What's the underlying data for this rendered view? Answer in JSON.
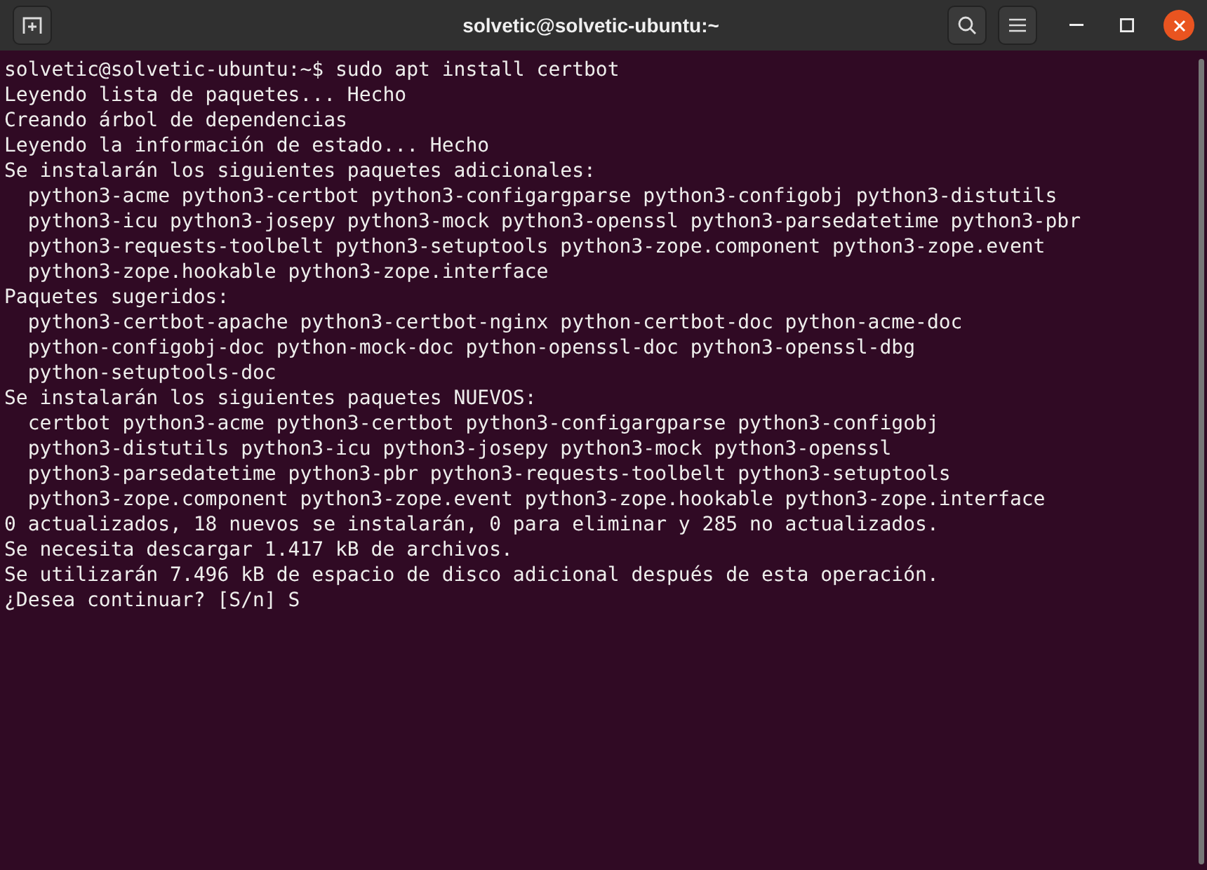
{
  "window": {
    "title": "solvetic@solvetic-ubuntu:~"
  },
  "terminal": {
    "lines": [
      "solvetic@solvetic-ubuntu:~$ sudo apt install certbot",
      "Leyendo lista de paquetes... Hecho",
      "Creando árbol de dependencias",
      "Leyendo la información de estado... Hecho",
      "Se instalarán los siguientes paquetes adicionales:",
      "  python3-acme python3-certbot python3-configargparse python3-configobj python3-distutils",
      "  python3-icu python3-josepy python3-mock python3-openssl python3-parsedatetime python3-pbr",
      "  python3-requests-toolbelt python3-setuptools python3-zope.component python3-zope.event",
      "  python3-zope.hookable python3-zope.interface",
      "Paquetes sugeridos:",
      "  python3-certbot-apache python3-certbot-nginx python-certbot-doc python-acme-doc",
      "  python-configobj-doc python-mock-doc python-openssl-doc python3-openssl-dbg",
      "  python-setuptools-doc",
      "Se instalarán los siguientes paquetes NUEVOS:",
      "  certbot python3-acme python3-certbot python3-configargparse python3-configobj",
      "  python3-distutils python3-icu python3-josepy python3-mock python3-openssl",
      "  python3-parsedatetime python3-pbr python3-requests-toolbelt python3-setuptools",
      "  python3-zope.component python3-zope.event python3-zope.hookable python3-zope.interface",
      "0 actualizados, 18 nuevos se instalarán, 0 para eliminar y 285 no actualizados.",
      "Se necesita descargar 1.417 kB de archivos.",
      "Se utilizarán 7.496 kB de espacio de disco adicional después de esta operación.",
      "¿Desea continuar? [S/n] S"
    ]
  }
}
